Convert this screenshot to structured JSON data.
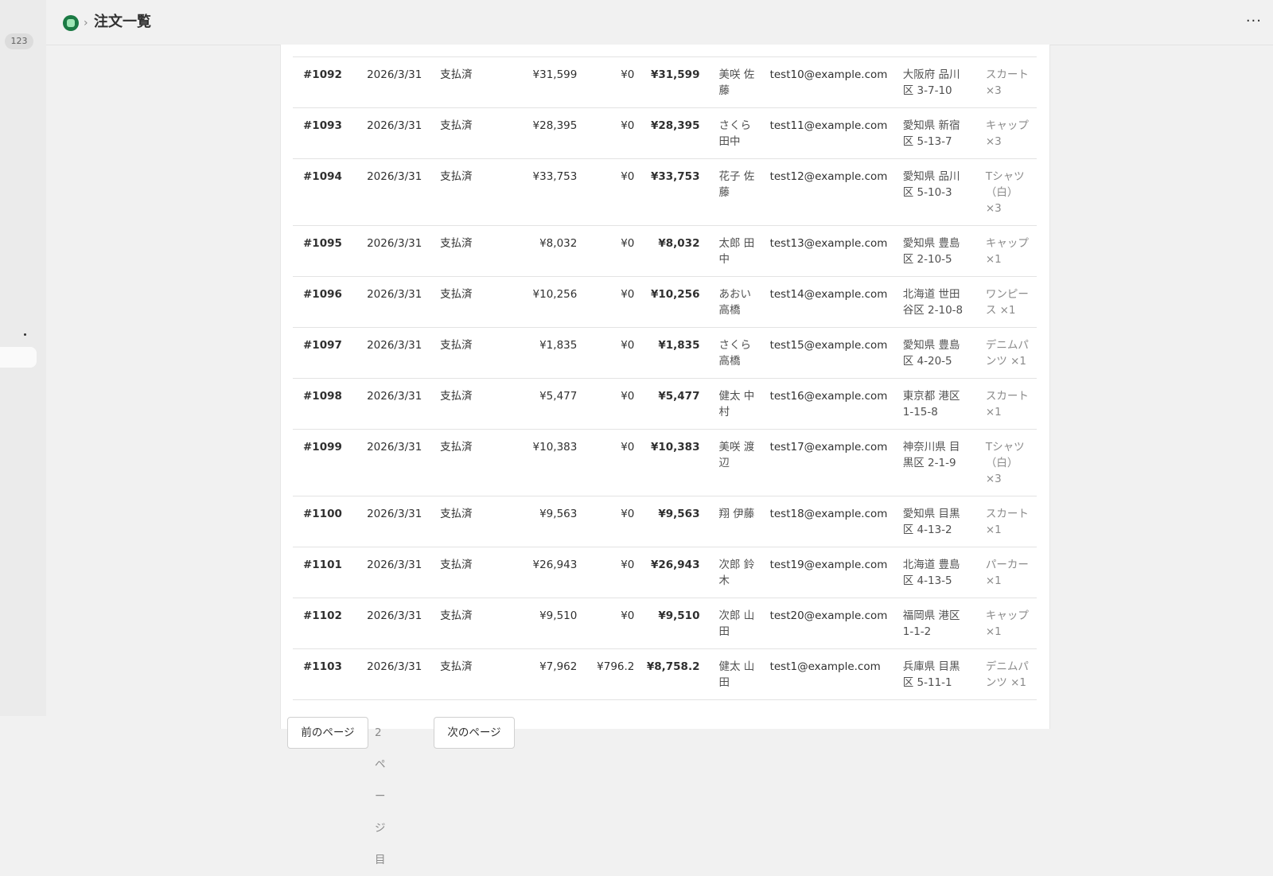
{
  "sidebar": {
    "badge_count": "123"
  },
  "header": {
    "title": "注文一覧",
    "separator": "›",
    "more": "···"
  },
  "orders": [
    {
      "id": "#1092",
      "date": "2026/3/31",
      "status": "支払済",
      "subtotal": "¥31,599",
      "discount": "¥0",
      "total": "¥31,599",
      "name": "美咲 佐藤",
      "email": "test10@example.com",
      "address": "大阪府 品川区 3-7-10",
      "items": "スカート ×3"
    },
    {
      "id": "#1093",
      "date": "2026/3/31",
      "status": "支払済",
      "subtotal": "¥28,395",
      "discount": "¥0",
      "total": "¥28,395",
      "name": "さくら 田中",
      "email": "test11@example.com",
      "address": "愛知県 新宿区 5-13-7",
      "items": "キャップ ×3"
    },
    {
      "id": "#1094",
      "date": "2026/3/31",
      "status": "支払済",
      "subtotal": "¥33,753",
      "discount": "¥0",
      "total": "¥33,753",
      "name": "花子 佐藤",
      "email": "test12@example.com",
      "address": "愛知県 品川区 5-10-3",
      "items": "Tシャツ（白） ×3"
    },
    {
      "id": "#1095",
      "date": "2026/3/31",
      "status": "支払済",
      "subtotal": "¥8,032",
      "discount": "¥0",
      "total": "¥8,032",
      "name": "太郎 田中",
      "email": "test13@example.com",
      "address": "愛知県 豊島区 2-10-5",
      "items": "キャップ ×1"
    },
    {
      "id": "#1096",
      "date": "2026/3/31",
      "status": "支払済",
      "subtotal": "¥10,256",
      "discount": "¥0",
      "total": "¥10,256",
      "name": "あおい 高橋",
      "email": "test14@example.com",
      "address": "北海道 世田谷区 2-10-8",
      "items": "ワンピース ×1"
    },
    {
      "id": "#1097",
      "date": "2026/3/31",
      "status": "支払済",
      "subtotal": "¥1,835",
      "discount": "¥0",
      "total": "¥1,835",
      "name": "さくら 高橋",
      "email": "test15@example.com",
      "address": "愛知県 豊島区 4-20-5",
      "items": "デニムパンツ ×1"
    },
    {
      "id": "#1098",
      "date": "2026/3/31",
      "status": "支払済",
      "subtotal": "¥5,477",
      "discount": "¥0",
      "total": "¥5,477",
      "name": "健太 中村",
      "email": "test16@example.com",
      "address": "東京都 港区 1-15-8",
      "items": "スカート ×1"
    },
    {
      "id": "#1099",
      "date": "2026/3/31",
      "status": "支払済",
      "subtotal": "¥10,383",
      "discount": "¥0",
      "total": "¥10,383",
      "name": "美咲 渡辺",
      "email": "test17@example.com",
      "address": "神奈川県 目黒区 2-1-9",
      "items": "Tシャツ（白） ×3"
    },
    {
      "id": "#1100",
      "date": "2026/3/31",
      "status": "支払済",
      "subtotal": "¥9,563",
      "discount": "¥0",
      "total": "¥9,563",
      "name": "翔 伊藤",
      "email": "test18@example.com",
      "address": "愛知県 目黒区 4-13-2",
      "items": "スカート ×1"
    },
    {
      "id": "#1101",
      "date": "2026/3/31",
      "status": "支払済",
      "subtotal": "¥26,943",
      "discount": "¥0",
      "total": "¥26,943",
      "name": "次郎 鈴木",
      "email": "test19@example.com",
      "address": "北海道 豊島区 4-13-5",
      "items": "パーカー ×1"
    },
    {
      "id": "#1102",
      "date": "2026/3/31",
      "status": "支払済",
      "subtotal": "¥9,510",
      "discount": "¥0",
      "total": "¥9,510",
      "name": "次郎 山田",
      "email": "test20@example.com",
      "address": "福岡県 港区 1-1-2",
      "items": "キャップ ×1"
    },
    {
      "id": "#1103",
      "date": "2026/3/31",
      "status": "支払済",
      "subtotal": "¥7,962",
      "discount": "¥796.2",
      "total": "¥8,758.2",
      "name": "健太 山田",
      "email": "test1@example.com",
      "address": "兵庫県 目黒区 5-11-1",
      "items": "デニムパンツ ×1"
    }
  ],
  "pagination": {
    "prev_label": "前のページ",
    "page_label": "2 ページ目",
    "next_label": "次のページ"
  },
  "colors": {
    "background": "#f1f1f1",
    "card": "#ffffff",
    "brand_icon": "#1b7a44"
  }
}
